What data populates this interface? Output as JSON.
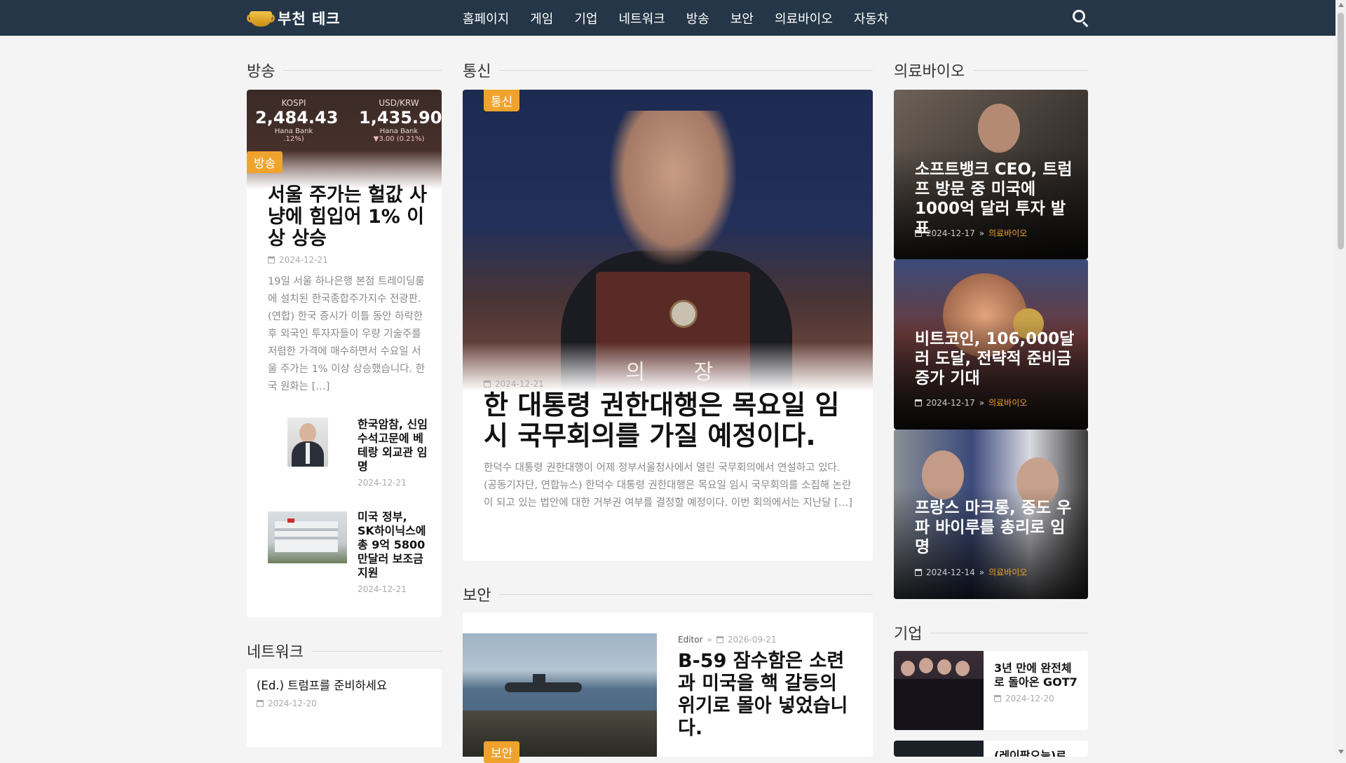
{
  "header": {
    "logo_text": "부천 테크",
    "nav": [
      "홈페이지",
      "게임",
      "기업",
      "네트워크",
      "방송",
      "보안",
      "의료바이오",
      "자동차"
    ]
  },
  "sections": {
    "broadcast": "방송",
    "telecom": "통신",
    "medbio": "의료바이오",
    "network": "네트워크",
    "security": "보안",
    "company": "기업"
  },
  "left_main": {
    "stock": {
      "kospi_label": "KOSPI",
      "kospi_value": "2,484.43",
      "kospi_bank": "Hana Bank",
      "kospi_change": ".12%)",
      "usd_label": "USD/KRW",
      "usd_value": "1,435.90",
      "usd_bank": "Hana Bank",
      "usd_change": "▼3.00 (0.21%)"
    },
    "badge": "방송",
    "title": "서울 주가는 헐값 사냥에 힘입어 1% 이상 상승",
    "date": "2024-12-21",
    "excerpt": "19일 서울 하나은행 본점 트레이딩룸에 설치된 한국종합주가지수 전광판. (연합) 한국 증시가 이틀 동안 하락한 후 외국인 투자자들이 우량 기술주를 저렴한 가격에 매수하면서 수요일 서울 주가는 1% 이상 상승했습니다. 한국 원화는 […]"
  },
  "left_small": [
    {
      "title": "한국암참, 신임 수석고문에 베테랑 외교관 임명",
      "date": "2024-12-21"
    },
    {
      "title": "미국 정부, SK하이닉스에 총 9억 5800만달러 보조금 지원",
      "date": "2024-12-21"
    }
  ],
  "network_item": {
    "title": "(Ed.) 트럼프를 준비하세요",
    "date": "2024-12-20"
  },
  "center_main": {
    "badge": "통신",
    "date": "2024-12-21",
    "title": "한 대통령 권한대행은 목요일 임시 국무회의를 가질 예정이다.",
    "excerpt": "한덕수 대통령 권한대행이 어제 정부서울청사에서 열린 국무회의에서 연설하고 있다. (공동기자단, 연합뉴스) 한덕수 대통령 권한대행은 목요일 임시 국무회의를 소집해 논란이 되고 있는 법안에 대한 거부권 여부를 결정할 예정이다. 이번 회의에서는 지난달 […]",
    "podium_text": "의 장"
  },
  "security_item": {
    "badge": "보안",
    "author": "Editor",
    "date": "2026-09-21",
    "title": "B-59 잠수함은 소련과 미국을 핵 갈등의 위기로 몰아 넣었습니다."
  },
  "right_cards": [
    {
      "title": "소프트뱅크 CEO, 트럼프 방문 중 미국에 1000억 달러 투자 발표",
      "date": "2024-12-17",
      "cat": "의료바이오"
    },
    {
      "title": "비트코인, 106,000달러 도달, 전략적 준비금 증가 기대",
      "date": "2024-12-17",
      "cat": "의료바이오"
    },
    {
      "title": "프랑스 마크롱, 중도 우파 바이루를 총리로 임명",
      "date": "2024-12-14",
      "cat": "의료바이오"
    }
  ],
  "company_items": [
    {
      "title": "3년 만에 완전체로 돌아온 GOT7",
      "date": "2024-12-20"
    },
    {
      "title": "(레이팡오늘)로",
      "date": ""
    }
  ],
  "colors": {
    "topbar": "#243647",
    "accent": "#f0a32c",
    "bg": "#f4f4f4"
  }
}
